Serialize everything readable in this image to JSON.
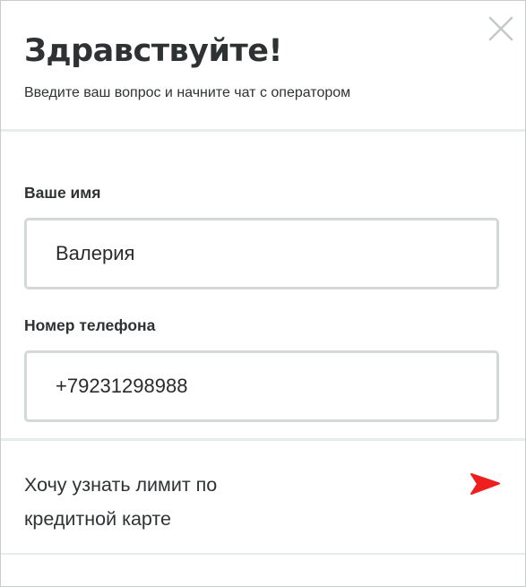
{
  "header": {
    "title": "Здравствуйте!",
    "subtitle": "Введите ваш вопрос и начните чат с оператором",
    "close_icon": "close-icon"
  },
  "form": {
    "name": {
      "label": "Ваше имя",
      "value": "Валерия"
    },
    "phone": {
      "label": "Номер телефона",
      "value": "+79231298988"
    }
  },
  "message": {
    "text": "Хочу узнать лимит по\nкредитной карте",
    "send_icon": "send-arrow-icon"
  },
  "colors": {
    "accent": "#ef1f1f",
    "border": "#d3d8d8",
    "divider": "#e9ecec",
    "close": "#c4c8c8"
  }
}
